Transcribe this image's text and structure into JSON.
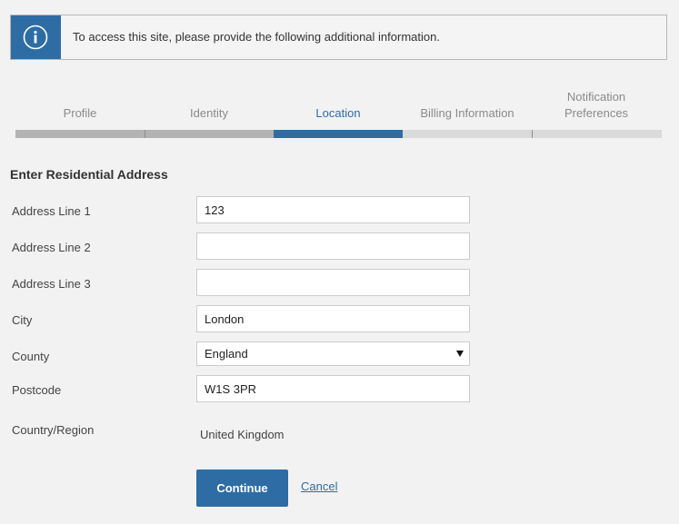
{
  "banner": {
    "icon": "info-icon",
    "message": "To access this site, please provide the following additional information."
  },
  "steps": [
    {
      "label": "Profile",
      "state": "done"
    },
    {
      "label": "Identity",
      "state": "done"
    },
    {
      "label": "Location",
      "state": "active"
    },
    {
      "label": "Billing Information",
      "state": "todo"
    },
    {
      "label": "Notification Preferences",
      "state": "todo"
    }
  ],
  "form": {
    "title": "Enter Residential Address",
    "address_line1": {
      "label": "Address Line 1",
      "value": "123"
    },
    "address_line2": {
      "label": "Address Line 2",
      "value": ""
    },
    "address_line3": {
      "label": "Address Line 3",
      "value": ""
    },
    "city": {
      "label": "City",
      "value": "London"
    },
    "county": {
      "label": "County",
      "value": "England"
    },
    "postcode": {
      "label": "Postcode",
      "value": "W1S 3PR"
    },
    "country": {
      "label": "Country/Region",
      "value": "United Kingdom"
    }
  },
  "actions": {
    "continue_label": "Continue",
    "cancel_label": "Cancel"
  },
  "colors": {
    "accent": "#2e6da4",
    "step_done": "#b3b3b3",
    "step_todo": "#dadada"
  }
}
